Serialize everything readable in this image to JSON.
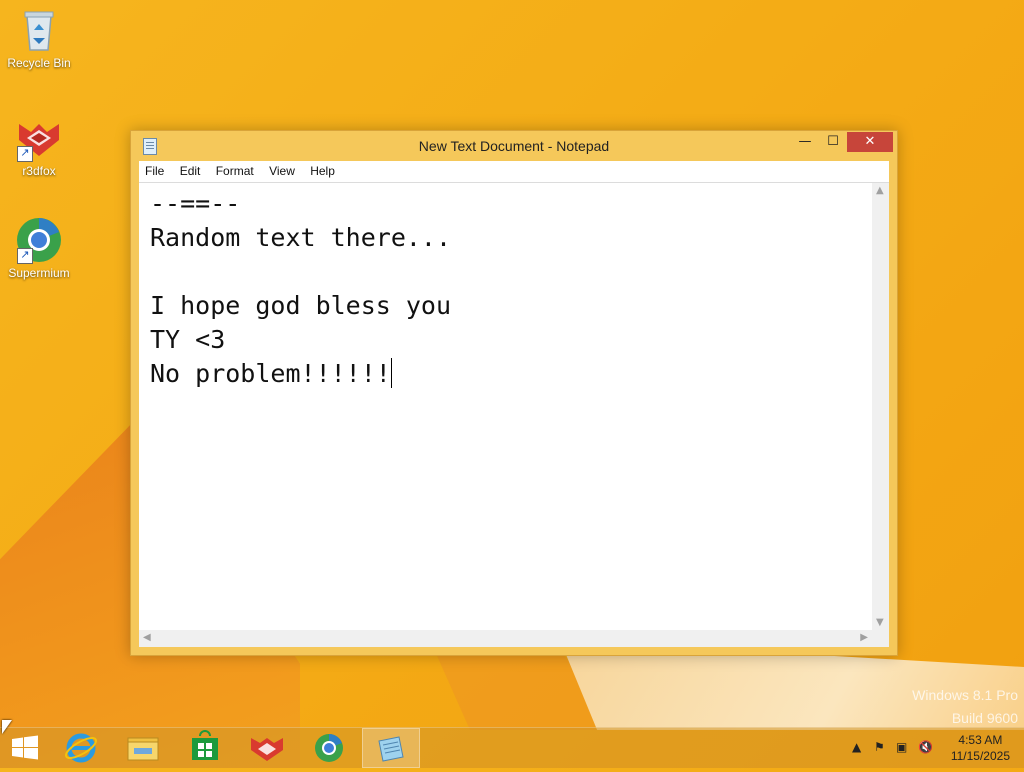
{
  "desktop": {
    "icons": [
      {
        "label": "Recycle Bin"
      },
      {
        "label": "r3dfox"
      },
      {
        "label": "Supermium"
      }
    ]
  },
  "window": {
    "title": "New Text Document - Notepad",
    "buttons": {
      "minimize": "—",
      "maximize": "☐",
      "close": "✕"
    },
    "menu": [
      "File",
      "Edit",
      "Format",
      "View",
      "Help"
    ],
    "text_lines": [
      "--==--",
      "Random text there...",
      "",
      "I hope god bless you",
      "TY <3",
      "No problem!!!!!!"
    ]
  },
  "watermark": {
    "line1": "Windows 8.1 Pro",
    "line2": "Build 9600"
  },
  "taskbar": {
    "items": [
      "start",
      "internet-explorer",
      "file-explorer",
      "store",
      "r3dfox",
      "supermium",
      "notepad"
    ],
    "active": "notepad",
    "clock": {
      "time": "4:53 AM",
      "date": "11/15/2025"
    }
  },
  "colors": {
    "accent": "#f4ac16",
    "close": "#c7453a",
    "window_frame": "#f5c85a"
  }
}
